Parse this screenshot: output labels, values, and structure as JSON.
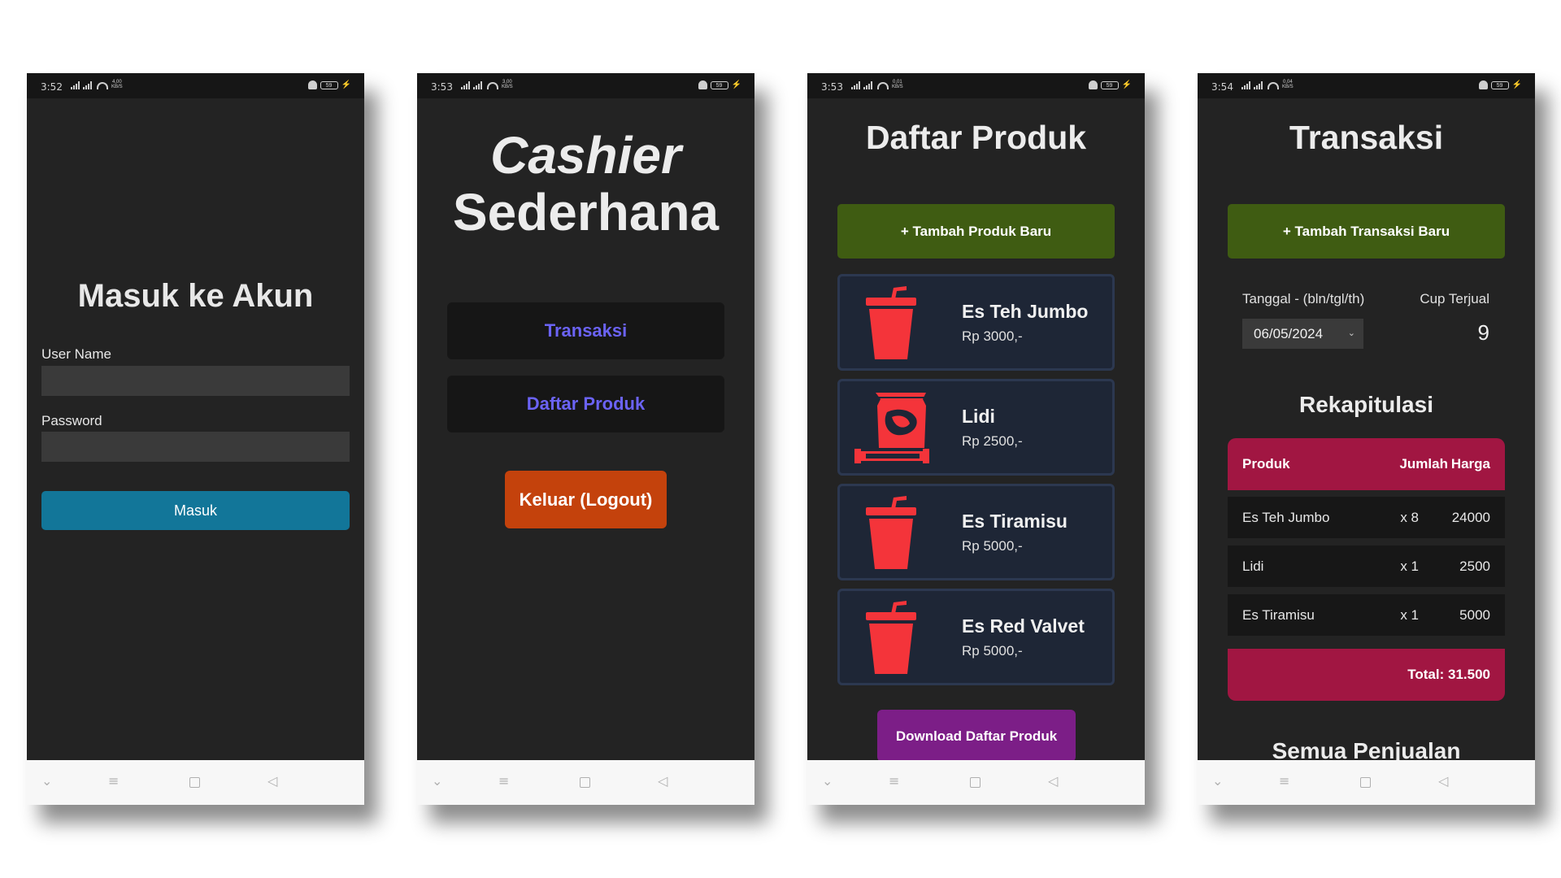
{
  "screens": [
    {
      "status": {
        "time": "3:52",
        "speed": "4,00",
        "unit": "KB/S",
        "battery": "59"
      },
      "title": "Masuk ke Akun",
      "username_label": "User Name",
      "password_label": "Password",
      "login_button": "Masuk"
    },
    {
      "status": {
        "time": "3:53",
        "speed": "3,00",
        "unit": "KB/S",
        "battery": "59"
      },
      "title_line1": "Cashier",
      "title_line2": "Sederhana",
      "menu": [
        "Transaksi",
        "Daftar Produk"
      ],
      "logout_button": "Keluar (Logout)"
    },
    {
      "status": {
        "time": "3:53",
        "speed": "0,01",
        "unit": "KB/S",
        "battery": "59"
      },
      "title": "Daftar Produk",
      "add_button": "+ Tambah Produk Baru",
      "products": [
        {
          "name": "Es Teh Jumbo",
          "price": "Rp 3000,-",
          "icon": "cup-icon"
        },
        {
          "name": "Lidi",
          "price": "Rp 2500,-",
          "icon": "snack-icon"
        },
        {
          "name": "Es Tiramisu",
          "price": "Rp 5000,-",
          "icon": "cup-icon"
        },
        {
          "name": "Es Red Valvet",
          "price": "Rp 5000,-",
          "icon": "cup-icon"
        }
      ],
      "download_button": "Download Daftar Produk"
    },
    {
      "status": {
        "time": "3:54",
        "speed": "0,04",
        "unit": "KB/S",
        "battery": "59"
      },
      "title": "Transaksi",
      "add_button": "+ Tambah Transaksi Baru",
      "date_label": "Tanggal - (bln/tgl/th)",
      "date_value": "06/05/2024",
      "cup_label": "Cup Terjual",
      "cup_value": "9",
      "recap_title": "Rekapitulasi",
      "table": {
        "headers": [
          "Produk",
          "Jumlah",
          "Harga"
        ],
        "rows": [
          [
            "Es Teh Jumbo",
            "x 8",
            "24000"
          ],
          [
            "Lidi",
            "x 1",
            "2500"
          ],
          [
            "Es Tiramisu",
            "x 1",
            "5000"
          ]
        ],
        "total": "Total: 31.500"
      },
      "all_sales_title": "Semua Penjualan"
    }
  ],
  "colors": {
    "screen_bg": "#232323",
    "login_button": "#127699",
    "menu_text": "#6b63f5",
    "logout_button": "#c4420c",
    "green_button": "#3f5c12",
    "product_card": "#1e2636",
    "product_icon": "#f4343a",
    "download_button": "#7c1e87",
    "table_accent": "#a11642"
  }
}
